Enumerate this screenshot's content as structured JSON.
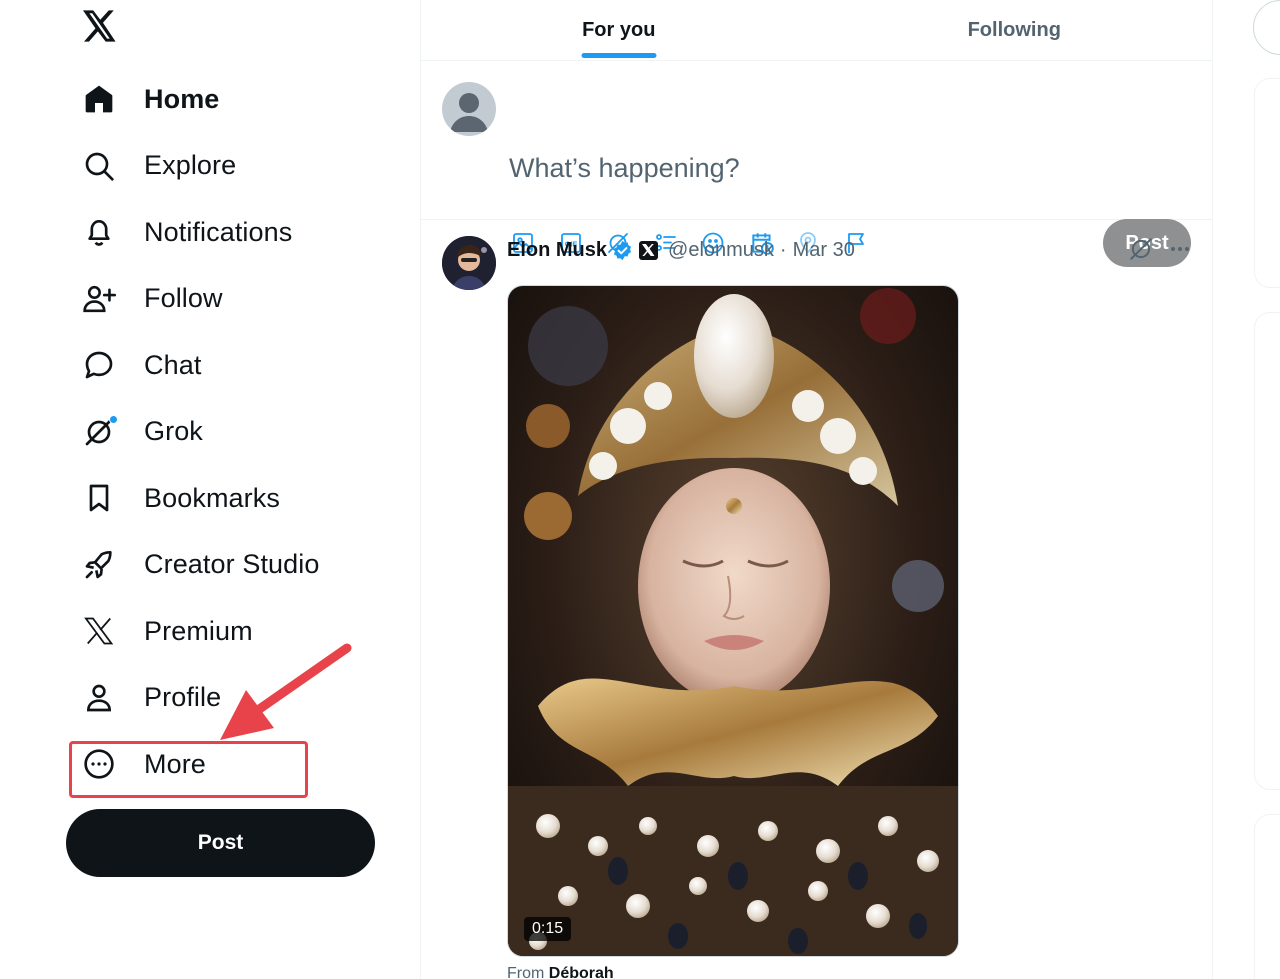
{
  "sidebar": {
    "logo": "x-logo-icon",
    "items": [
      {
        "label": "Home",
        "icon": "home-icon",
        "active": true
      },
      {
        "label": "Explore",
        "icon": "search-icon"
      },
      {
        "label": "Notifications",
        "icon": "bell-icon"
      },
      {
        "label": "Follow",
        "icon": "add-person-icon"
      },
      {
        "label": "Chat",
        "icon": "chat-bubble-icon"
      },
      {
        "label": "Grok",
        "icon": "grok-icon"
      },
      {
        "label": "Bookmarks",
        "icon": "bookmark-icon"
      },
      {
        "label": "Creator Studio",
        "icon": "rocket-icon"
      },
      {
        "label": "Premium",
        "icon": "x-logo-icon"
      },
      {
        "label": "Profile",
        "icon": "person-icon"
      },
      {
        "label": "More",
        "icon": "more-circle-icon"
      }
    ],
    "post_label": "Post"
  },
  "tabs": [
    {
      "label": "For you",
      "active": true
    },
    {
      "label": "Following",
      "active": false
    }
  ],
  "composer": {
    "placeholder": "What’s happening?",
    "post_label": "Post",
    "tools": [
      "image-icon",
      "gif-icon",
      "grok-icon",
      "poll-icon",
      "emoji-icon",
      "schedule-icon",
      "location-icon",
      "flag-icon"
    ]
  },
  "tweet": {
    "name": "Elon Musk",
    "handle": "@elonmusk",
    "separator": "·",
    "date": "Mar 30",
    "video_duration": "0:15",
    "from_prefix": "From",
    "from_name": "Déborah"
  },
  "colors": {
    "accent": "#1d9bf0",
    "text": "#0f1419",
    "muted": "#536471",
    "annotation": "#e8434a",
    "post_disabled": "#8e9092"
  }
}
